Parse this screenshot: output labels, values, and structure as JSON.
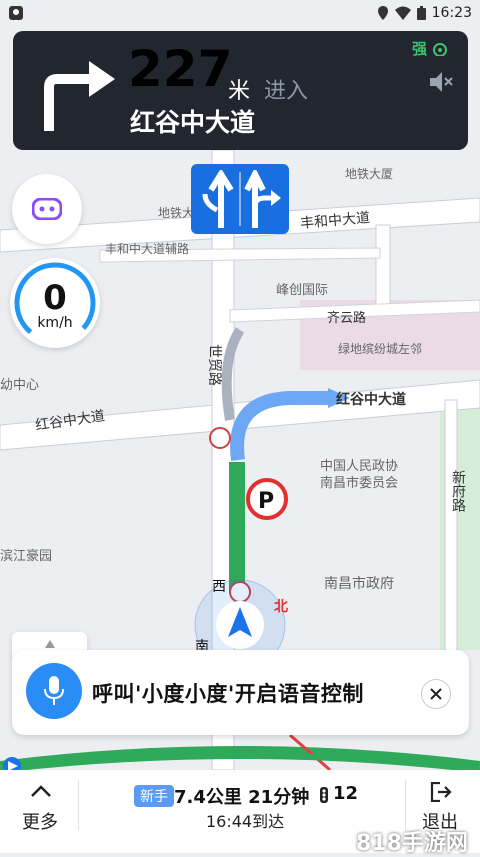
{
  "status_bar": {
    "time": "16:23",
    "icons": [
      "map-pin-icon",
      "wifi-icon",
      "battery-icon"
    ]
  },
  "banner": {
    "turn_icon": "turn-right-icon",
    "distance": "227",
    "unit": "米",
    "action": "进入",
    "road": "红谷中大道",
    "signal": "强",
    "mute_icon": "speaker-mute-icon"
  },
  "speed": {
    "value": "0",
    "unit": "km/h"
  },
  "map": {
    "roads": [
      "丰和中大道",
      "丰和中大道辅路",
      "齐云路",
      "世贸路",
      "红谷中大道",
      "红谷中大道",
      "新府路"
    ],
    "pois": [
      "地铁大厦",
      "地铁大厦",
      "峰创国际",
      "绿地缤纷城左邻",
      "幼中心",
      "中国人民政协",
      "南昌市委员会",
      "南昌市政府",
      "滨江豪园"
    ],
    "compass": {
      "north": "北",
      "west": "西",
      "south": "南"
    }
  },
  "voice": {
    "prompt": "呼叫'小度小度'开启语音控制"
  },
  "bottom": {
    "more_label": "更多",
    "newbie_badge": "新手",
    "trip": "7.4公里 21分钟",
    "traffic_lights": "12",
    "arrival": "16:44到达",
    "exit_label": "退出"
  },
  "watermark": "818手游网",
  "colors": {
    "route": "#2eaa5a",
    "accent": "#1a73e8",
    "banner_bg": "#22262e"
  }
}
